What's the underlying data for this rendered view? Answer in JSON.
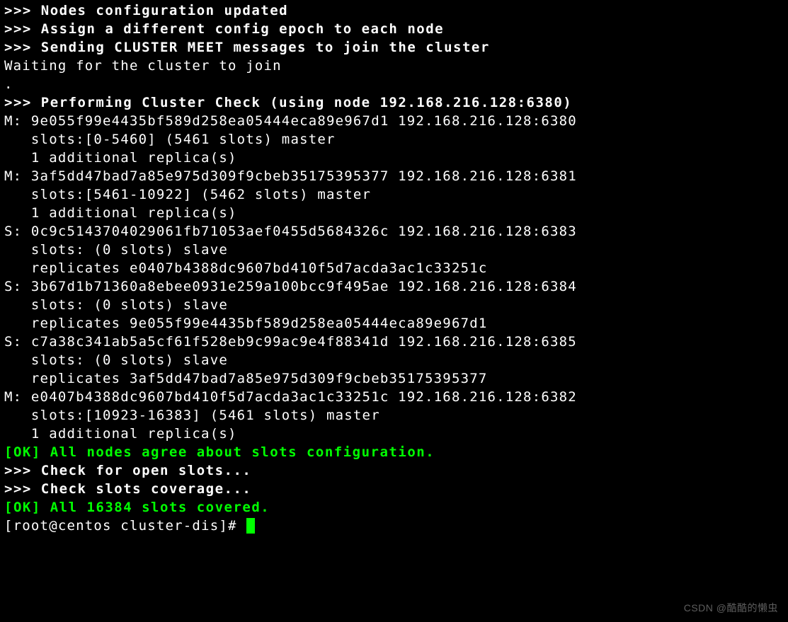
{
  "msg_nodes_updated": ">>> Nodes configuration updated",
  "msg_assign_epoch": ">>> Assign a different config epoch to each node",
  "msg_sending_meet": ">>> Sending CLUSTER MEET messages to join the cluster",
  "msg_waiting": "Waiting for the cluster to join",
  "msg_dot": ".",
  "msg_perform_check": ">>> Performing Cluster Check (using node 192.168.216.128:6380)",
  "nodes": [
    {
      "role": "M",
      "id": "9e055f99e4435bf589d258ea05444eca89e967d1",
      "addr": "192.168.216.128:6380",
      "slots_line": "   slots:[0-5460] (5461 slots) master",
      "extra_line": "   1 additional replica(s)"
    },
    {
      "role": "M",
      "id": "3af5dd47bad7a85e975d309f9cbeb35175395377",
      "addr": "192.168.216.128:6381",
      "slots_line": "   slots:[5461-10922] (5462 slots) master",
      "extra_line": "   1 additional replica(s)"
    },
    {
      "role": "S",
      "id": "0c9c5143704029061fb71053aef0455d5684326c",
      "addr": "192.168.216.128:6383",
      "slots_line": "   slots: (0 slots) slave",
      "extra_line": "   replicates e0407b4388dc9607bd410f5d7acda3ac1c33251c"
    },
    {
      "role": "S",
      "id": "3b67d1b71360a8ebee0931e259a100bcc9f495ae",
      "addr": "192.168.216.128:6384",
      "slots_line": "   slots: (0 slots) slave",
      "extra_line": "   replicates 9e055f99e4435bf589d258ea05444eca89e967d1"
    },
    {
      "role": "S",
      "id": "c7a38c341ab5a5cf61f528eb9c99ac9e4f88341d",
      "addr": "192.168.216.128:6385",
      "slots_line": "   slots: (0 slots) slave",
      "extra_line": "   replicates 3af5dd47bad7a85e975d309f9cbeb35175395377"
    },
    {
      "role": "M",
      "id": "e0407b4388dc9607bd410f5d7acda3ac1c33251c",
      "addr": "192.168.216.128:6382",
      "slots_line": "   slots:[10923-16383] (5461 slots) master",
      "extra_line": "   1 additional replica(s)"
    }
  ],
  "ok_agree": "[OK] All nodes agree about slots configuration.",
  "check_open_slots": ">>> Check for open slots...",
  "check_slots_coverage": ">>> Check slots coverage...",
  "ok_covered": "[OK] All 16384 slots covered.",
  "prompt": "[root@centos cluster-dis]# ",
  "watermark": "CSDN @酷酷的懒虫"
}
